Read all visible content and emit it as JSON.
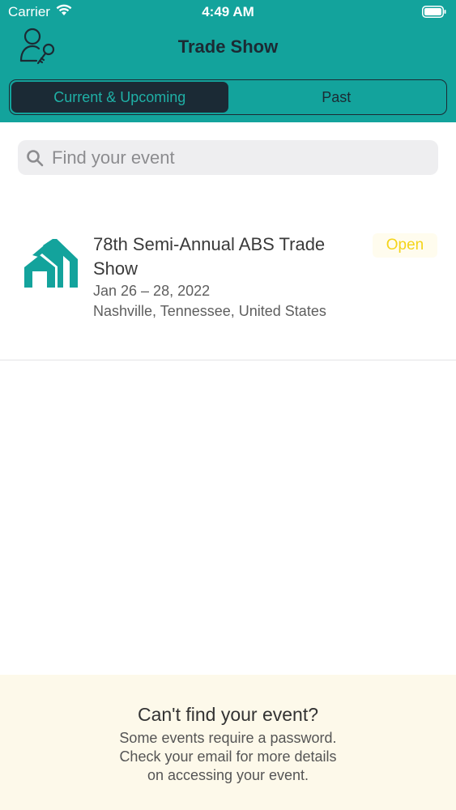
{
  "status_bar": {
    "carrier": "Carrier",
    "time": "4:49 AM"
  },
  "nav": {
    "title": "Trade Show",
    "user_icon": "user-key-icon"
  },
  "segments": {
    "tabs": [
      {
        "label": "Current & Upcoming",
        "selected": true
      },
      {
        "label": "Past",
        "selected": false
      }
    ]
  },
  "search": {
    "placeholder": "Find your event",
    "value": ""
  },
  "events": [
    {
      "title": "78th Semi-Annual ABS Trade Show",
      "dates": "Jan 26 – 28, 2022",
      "location": "Nashville, Tennessee, United States",
      "status": "Open",
      "logo_icon": "house-logo-icon"
    }
  ],
  "footer": {
    "title": "Can't find your event?",
    "line1": "Some events require a password.",
    "line2": "Check your email for more details",
    "line3": "on accessing your event."
  },
  "colors": {
    "accent": "#13a39c",
    "dark": "#1b2a35",
    "status_open": "#f4d41a",
    "footer_bg": "#fdf9ea"
  }
}
